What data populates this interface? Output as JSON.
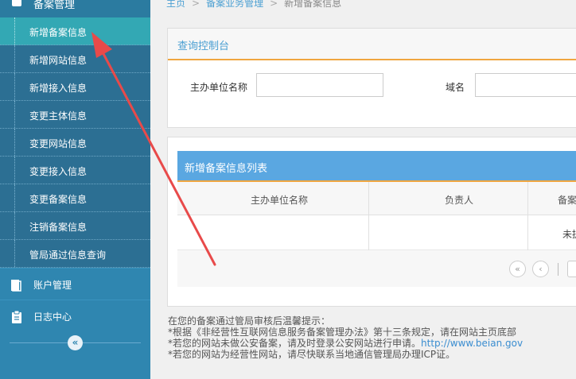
{
  "sidebar": {
    "section_title": "备案管理",
    "items": [
      {
        "label": "新增备案信息"
      },
      {
        "label": "新增网站信息"
      },
      {
        "label": "新增接入信息"
      },
      {
        "label": "变更主体信息"
      },
      {
        "label": "变更网站信息"
      },
      {
        "label": "变更接入信息"
      },
      {
        "label": "变更备案信息"
      },
      {
        "label": "注销备案信息"
      },
      {
        "label": "管局通过信息查询"
      }
    ],
    "account_label": "账户管理",
    "log_label": "日志中心",
    "collapse_glyph": "«"
  },
  "breadcrumb": {
    "home": "主页",
    "section": "备案业务管理",
    "current": "新增备案信息",
    "separator": ">"
  },
  "query": {
    "title": "查询控制台",
    "unit_label": "主办单位名称",
    "unit_value": "",
    "domain_label": "域名",
    "domain_value": ""
  },
  "list": {
    "title": "新增备案信息列表",
    "columns": [
      "主办单位名称",
      "负责人",
      "备案"
    ],
    "rows": [
      {
        "unit": "",
        "owner": "",
        "status": "未提"
      }
    ]
  },
  "pager": {
    "first_glyph": "«",
    "prev_glyph": "‹"
  },
  "notes": {
    "line1": "在您的备案通过管局审核后温馨提示：",
    "line2": "*根据《非经营性互联网信息服务备案管理办法》第十三条规定，请在网站主页底部",
    "line3_text": "*若您的网站未做公安备案，请及时登录公安网站进行申请。",
    "line3_link": "http://www.beian.gov",
    "line4": "*若您的网站为经营性网站，请尽快联系当地通信管理局办理ICP证。"
  },
  "colors": {
    "sidebar_bg": "#2c6f93",
    "sidebar_active": "#33a8b4",
    "list_header": "#5aa7e1",
    "accent_orange": "#f0a640",
    "annotation_arrow": "#e84a4a"
  }
}
